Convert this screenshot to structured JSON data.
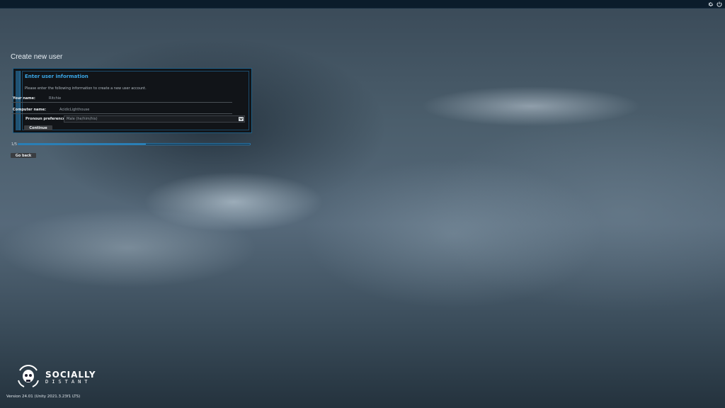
{
  "topbar": {
    "icons": [
      "gear-icon",
      "power-icon"
    ]
  },
  "page": {
    "title": "Create new user"
  },
  "form": {
    "heading": "Enter user information",
    "description": "Please enter the following information to create a new user account.",
    "name_label": "Your name:",
    "name_value": "Ritchie",
    "computer_label": "Computer name:",
    "computer_value": "AcidicLighthouse",
    "pronoun_label": "Pronoun preference:",
    "pronoun_value": "Male (he/him/his)",
    "continue_label": "Continue"
  },
  "progress": {
    "step_text": "1/5",
    "fraction": 0.55
  },
  "footer": {
    "go_back_label": "Go back",
    "logo_line1": "SOCIALLY",
    "logo_line2": "DISTANT",
    "version": "Version 24.01 (Unity 2021.3.23f1 LTS)"
  },
  "colors": {
    "accent": "#3aa6e6",
    "topbar": "#0b1c2b",
    "panel": "#111418"
  }
}
